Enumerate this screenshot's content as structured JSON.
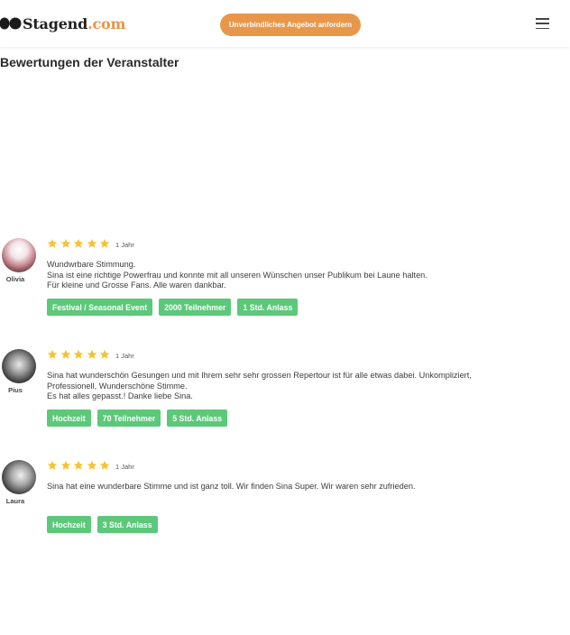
{
  "header": {
    "logo_text": "Stagend",
    "logo_tld": ".com",
    "cta_label": "Unverbindliches Angebot anfordern"
  },
  "section_title": "Bewertungen der Veranstalter",
  "reviews": [
    {
      "name": "Olivia",
      "rating": 5,
      "age": "1 Jahr",
      "lines": [
        "Wundwrbare Stimmung.",
        "Sina ist eine richtige Powerfrau und konnte mit all unseren Wünschen unser Publikum bei Laune halten.",
        "Für kleine und Grosse Fans. Alle waren dankbar."
      ],
      "tags": [
        "Festival / Seasonal Event",
        "2000 Teilnehmer",
        "1 Std. Anlass"
      ]
    },
    {
      "name": "Pius",
      "rating": 5,
      "age": "1 Jahr",
      "lines": [
        "Sina hat wunderschön Gesungen und mit Ihrem sehr sehr grossen Repertour ist für alle etwas dabei. Unkompliziert,",
        "Professionell, Wunderschöne Stimme.",
        "Es hat alles gepasst.! Danke liebe Sina."
      ],
      "tags": [
        "Hochzeit",
        "70 Teilnehmer",
        "5 Std. Anlass"
      ]
    },
    {
      "name": "Laura",
      "rating": 5,
      "age": "1 Jahr",
      "lines": [
        "Sina hat eine wunderbare Stimme und ist ganz toll. Wir finden Sina Super. Wir waren sehr zufrieden."
      ],
      "tags": [
        "Hochzeit",
        "3 Std. Anlass"
      ]
    }
  ],
  "colors": {
    "accent": "#e8974a",
    "tag_green": "#5cc87a",
    "star_yellow": "#f6c234"
  },
  "icons": {
    "logo": "two-dots-logo-icon",
    "menu": "hamburger-menu-icon",
    "star": "star-icon"
  }
}
